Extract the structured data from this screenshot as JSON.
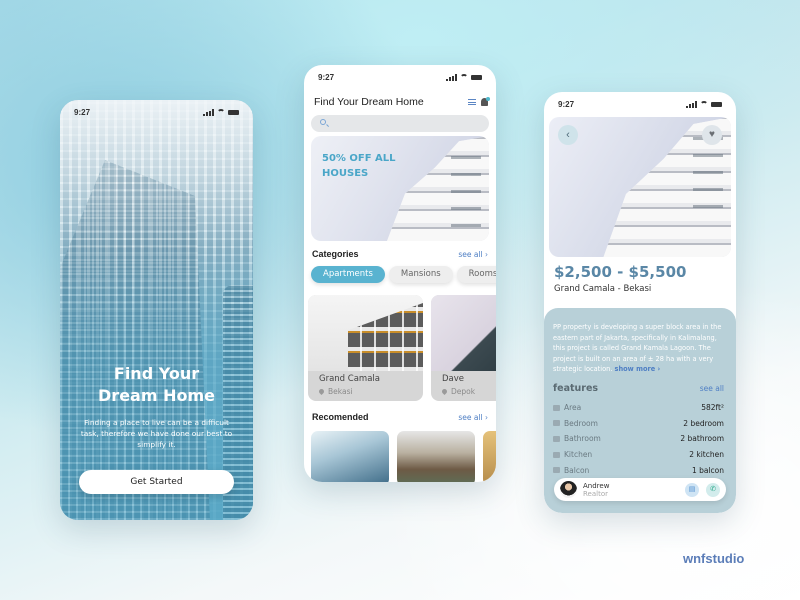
{
  "status_bar": {
    "time": "9:27"
  },
  "onboarding": {
    "title": "Find Your\nDream Home",
    "description": "Finding a place to live can be a difficult task, therefore we have done our best to simplify it.",
    "cta_label": "Get Started"
  },
  "home": {
    "title": "Find Your Dream Home",
    "search": {
      "value": "",
      "placeholder": ""
    },
    "promo_text": "50% OFF ALL\nHOUSES",
    "categories": {
      "title": "Categories",
      "see_all": "see all ›",
      "chips": [
        {
          "label": "Apartments",
          "active": true
        },
        {
          "label": "Mansions",
          "active": false
        },
        {
          "label": "Rooms",
          "active": false
        }
      ]
    },
    "listings": [
      {
        "name": "Grand Camala",
        "location": "Bekasi"
      },
      {
        "name": "Dave",
        "location": "Depok"
      }
    ],
    "recommended": {
      "title": "Recomended",
      "see_all": "see all ›"
    }
  },
  "detail": {
    "back_icon": "‹",
    "fav_icon": "♥",
    "price": "$2,500 - $5,500",
    "subtitle": "Grand Camala - Bekasi",
    "description": "PP property is developing a super block area in the eastern part of Jakarta, specifically in Kalimalang, this project is called Grand Kamala Lagoon. The project is built on an area of ± 28 ha with a very strategic location.",
    "show_more": "show more ›",
    "features_title": "features",
    "features_see_all": "see all",
    "features": [
      {
        "label": "Area",
        "value": "582ft²",
        "icon": "area-icon"
      },
      {
        "label": "Bedroom",
        "value": "2 bedroom",
        "icon": "bed-icon"
      },
      {
        "label": "Bathroom",
        "value": "2 bathroom",
        "icon": "bathtub-icon"
      },
      {
        "label": "Kitchen",
        "value": "2 kitchen",
        "icon": "kitchen-icon"
      },
      {
        "label": "Balcon",
        "value": "1 balcon",
        "icon": "balcony-icon"
      }
    ],
    "realtor": {
      "name": "Andrew",
      "role": "Realtor",
      "chat_icon": "▤",
      "call_icon": "✆"
    }
  },
  "brand": "wnfstudio",
  "colors": {
    "accent": "#59b3d0",
    "link": "#4f7fc4",
    "price": "#5a87a6",
    "panel": "#b8d0d8",
    "brand": "#5b7db8"
  }
}
